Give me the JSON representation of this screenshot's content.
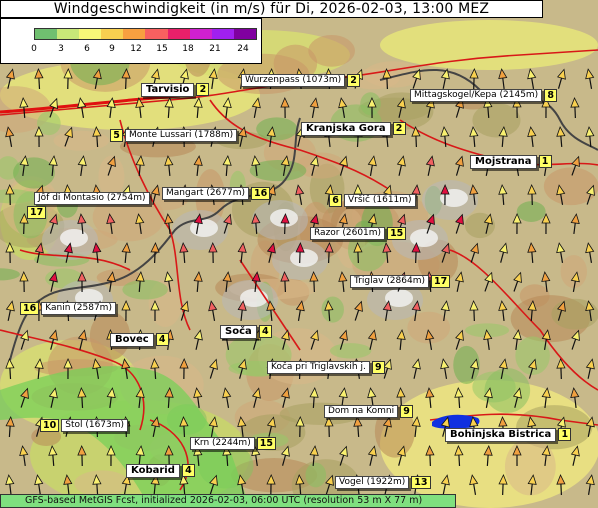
{
  "title": "Windgeschwindigkeit (in m/s) für Di, 2026-02-03, 13:00 MEZ",
  "legend": {
    "ticks": [
      "0",
      "3",
      "6",
      "9",
      "12",
      "15",
      "18",
      "21",
      "24"
    ],
    "colors": [
      "#70c070",
      "#c8e878",
      "#f8f878",
      "#f8d050",
      "#f8a040",
      "#f86060",
      "#e8206a",
      "#d020d0",
      "#a020f0",
      "#8000a0"
    ]
  },
  "footer": "GFS-based MetGIS Fcst, initialized 2026-02-03, 06:00 UTC  (resolution 53 m X 77 m)",
  "stations": [
    {
      "name": "Tarvisio",
      "value": "2",
      "type": "town"
    },
    {
      "name": "Wurzenpass (1073m)",
      "value": "2",
      "type": "peak"
    },
    {
      "name": "Mittagskogel/Kepa (2145m)",
      "value": "8",
      "type": "peak"
    },
    {
      "name": "Monte Lussari (1788m)",
      "value": "5",
      "type": "peak"
    },
    {
      "name": "Kranjska Gora",
      "value": "2",
      "type": "town"
    },
    {
      "name": "Mojstrana",
      "value": "1",
      "type": "town"
    },
    {
      "name": "Jôf di Montasio (2754m)",
      "value": "17",
      "type": "peak"
    },
    {
      "name": "Mangart (2677m)",
      "value": "16",
      "type": "peak"
    },
    {
      "name": "Vršič (1611m)",
      "value": "6",
      "type": "peak"
    },
    {
      "name": "Razor (2601m)",
      "value": "15",
      "type": "peak"
    },
    {
      "name": "Triglav (2864m)",
      "value": "17",
      "type": "peak"
    },
    {
      "name": "Kanin (2587m)",
      "value": "16",
      "type": "peak"
    },
    {
      "name": "Bovec",
      "value": "4",
      "type": "town"
    },
    {
      "name": "Soča",
      "value": "4",
      "type": "town"
    },
    {
      "name": "Koča pri Triglavskih j.",
      "value": "9",
      "type": "peak"
    },
    {
      "name": "Dom na Komni",
      "value": "9",
      "type": "peak"
    },
    {
      "name": "Stol (1673m)",
      "value": "10",
      "type": "peak"
    },
    {
      "name": "Bohinjska Bistrica",
      "value": "1",
      "type": "town"
    },
    {
      "name": "Krn (2244m)",
      "value": "15",
      "type": "peak"
    },
    {
      "name": "Kobarid",
      "value": "4",
      "type": "town"
    },
    {
      "name": "Vogel (1922m)",
      "value": "13",
      "type": "peak"
    }
  ]
}
